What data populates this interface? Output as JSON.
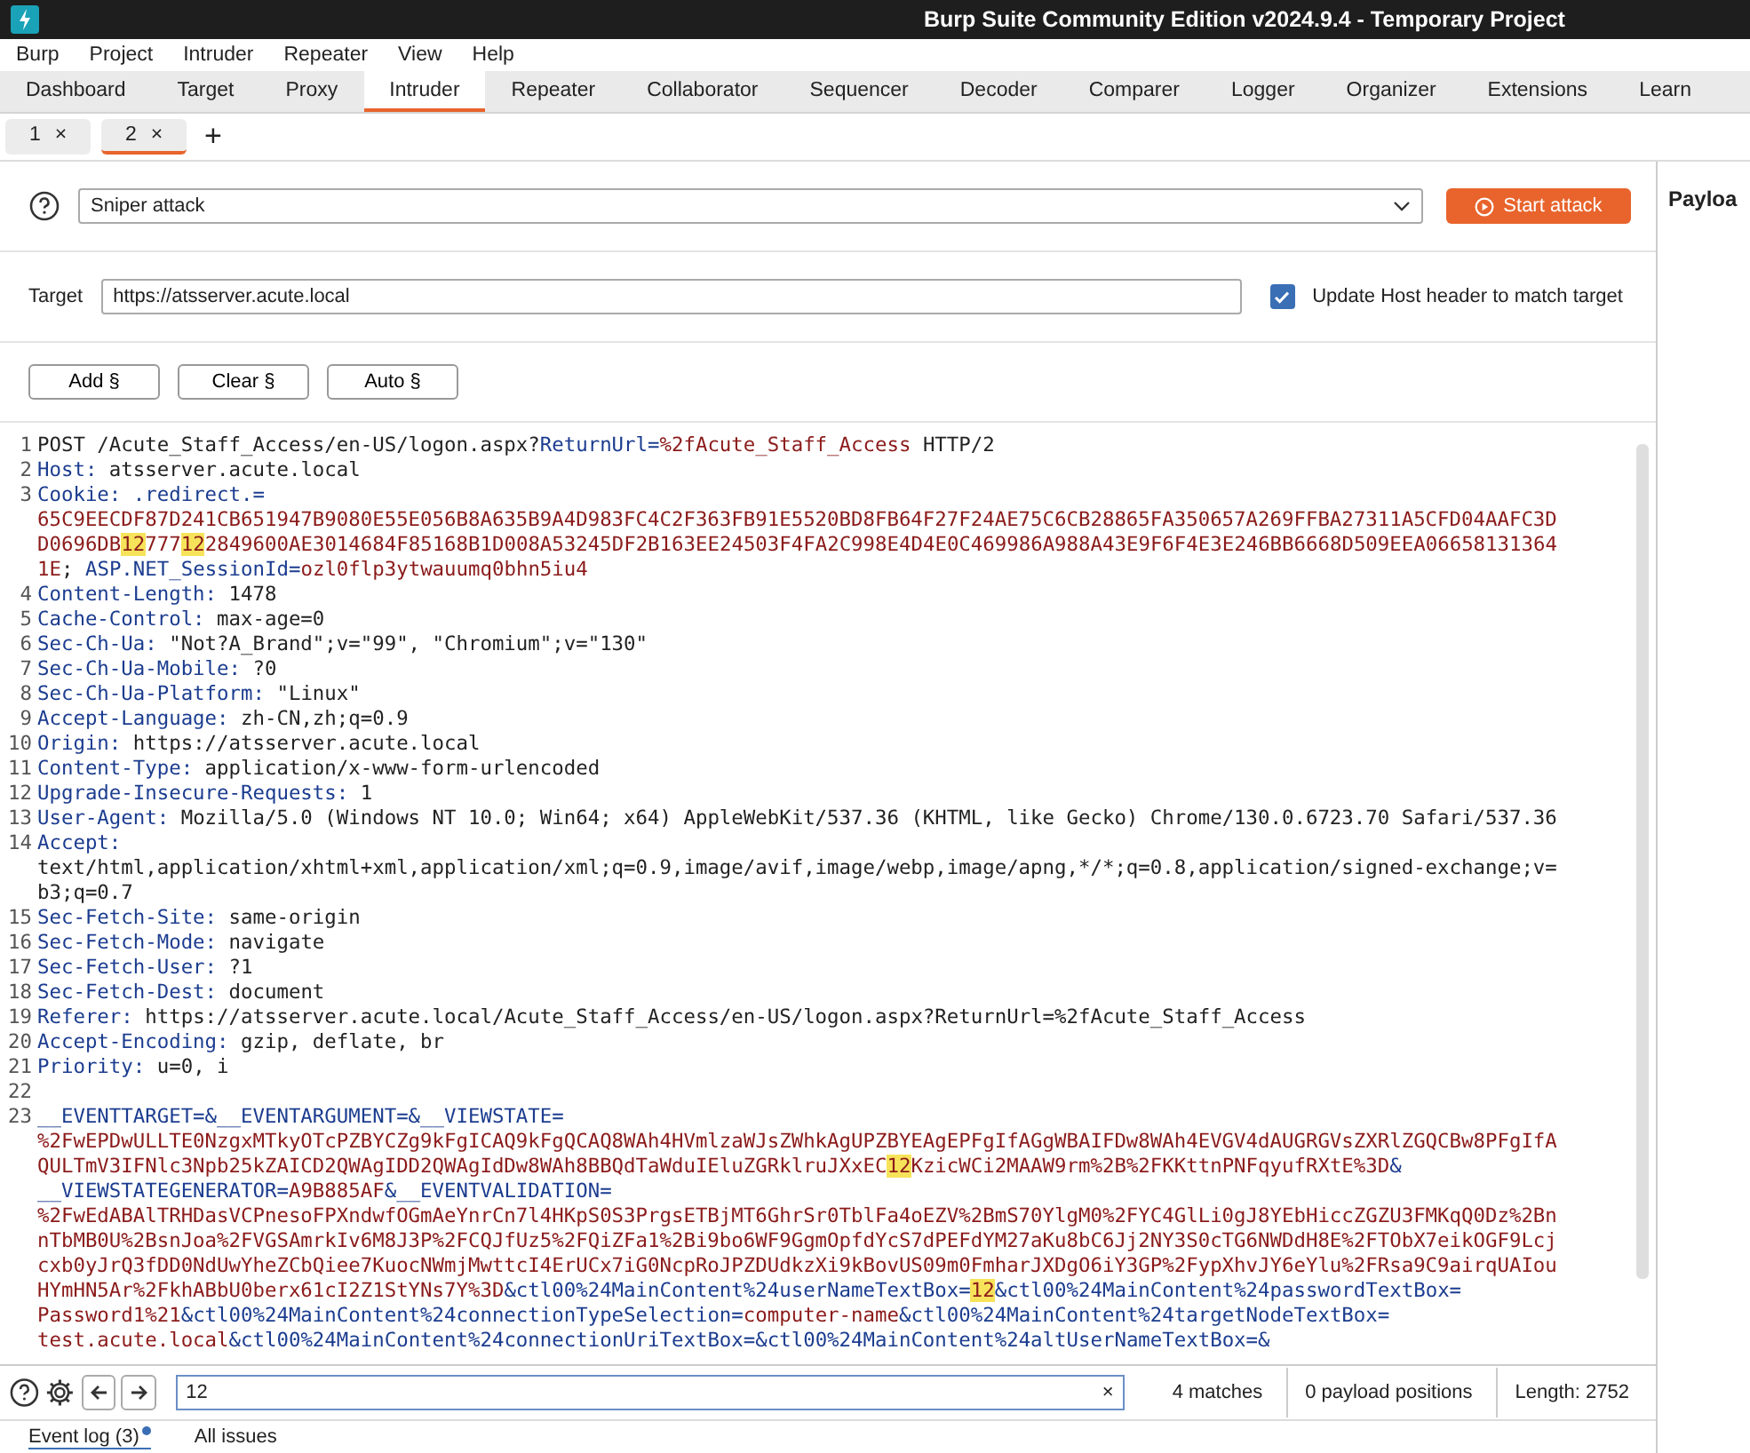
{
  "window": {
    "title": "Burp Suite Community Edition v2024.9.4 - Temporary Project"
  },
  "menu": [
    "Burp",
    "Project",
    "Intruder",
    "Repeater",
    "View",
    "Help"
  ],
  "tabs": [
    {
      "label": "Dashboard",
      "selected": false
    },
    {
      "label": "Target",
      "selected": false
    },
    {
      "label": "Proxy",
      "selected": false
    },
    {
      "label": "Intruder",
      "selected": true
    },
    {
      "label": "Repeater",
      "selected": false
    },
    {
      "label": "Collaborator",
      "selected": false
    },
    {
      "label": "Sequencer",
      "selected": false
    },
    {
      "label": "Decoder",
      "selected": false
    },
    {
      "label": "Comparer",
      "selected": false
    },
    {
      "label": "Logger",
      "selected": false
    },
    {
      "label": "Organizer",
      "selected": false
    },
    {
      "label": "Extensions",
      "selected": false
    },
    {
      "label": "Learn",
      "selected": false
    }
  ],
  "subtabs": [
    {
      "label": "1",
      "close": "×",
      "selected": false
    },
    {
      "label": "2",
      "close": "×",
      "selected": true
    }
  ],
  "new_tab": "+",
  "attack": {
    "type": "Sniper attack",
    "start_button": "Start attack"
  },
  "target": {
    "label": "Target",
    "value": "https://atsserver.acute.local",
    "update_host": {
      "label": "Update Host header to match target",
      "checked": true
    }
  },
  "position_buttons": [
    "Add §",
    "Clear §",
    "Auto §"
  ],
  "request_rows": [
    {
      "number": "1",
      "segments": [
        {
          "kind": "plain",
          "text": "POST /Acute_Staff_Access/en-US/logon.aspx?"
        },
        {
          "kind": "name",
          "text": "ReturnUrl="
        },
        {
          "kind": "value",
          "text": "%2fAcute_Staff_Access"
        },
        {
          "kind": "plain",
          "text": " HTTP/2"
        }
      ]
    },
    {
      "number": "2",
      "segments": [
        {
          "kind": "name",
          "text": "Host:"
        },
        {
          "kind": "plain",
          "text": " atsserver.acute.local"
        }
      ]
    },
    {
      "number": "3",
      "segments": [
        {
          "kind": "name",
          "text": "Cookie:"
        },
        {
          "kind": "name",
          "text": " .redirect.="
        }
      ]
    },
    {
      "segments": [
        {
          "kind": "value",
          "text": "65C9EECDF87D241CB651947B9080E55E056B8A635B9A4D983FC4C2F363FB91E5520BD8FB64F27F24AE75C6CB28865FA350657A269FFBA27311A5CFD04AAFC3D"
        }
      ]
    },
    {
      "segments": [
        {
          "kind": "value",
          "text": "D0696DB"
        },
        {
          "kind": "match",
          "text": "12"
        },
        {
          "kind": "value",
          "text": "777"
        },
        {
          "kind": "match",
          "text": "12"
        },
        {
          "kind": "value",
          "text": "2849600AE3014684F85168B1D008A53245DF2B163EE24503F4FA2C998E4D4E0C469986A988A43E9F6F4E3E246BB6668D509EEA06658131364"
        }
      ]
    },
    {
      "segments": [
        {
          "kind": "value",
          "text": "1E"
        },
        {
          "kind": "plain",
          "text": "; "
        },
        {
          "kind": "name",
          "text": "ASP.NET_SessionId="
        },
        {
          "kind": "value",
          "text": "ozl0flp3ytwauumq0bhn5iu4"
        }
      ]
    },
    {
      "number": "4",
      "segments": [
        {
          "kind": "name",
          "text": "Content-Length:"
        },
        {
          "kind": "plain",
          "text": " 1478"
        }
      ]
    },
    {
      "number": "5",
      "segments": [
        {
          "kind": "name",
          "text": "Cache-Control:"
        },
        {
          "kind": "plain",
          "text": " max-age=0"
        }
      ]
    },
    {
      "number": "6",
      "segments": [
        {
          "kind": "name",
          "text": "Sec-Ch-Ua:"
        },
        {
          "kind": "plain",
          "text": " \"Not?A_Brand\";v=\"99\", \"Chromium\";v=\"130\""
        }
      ]
    },
    {
      "number": "7",
      "segments": [
        {
          "kind": "name",
          "text": "Sec-Ch-Ua-Mobile:"
        },
        {
          "kind": "plain",
          "text": " ?0"
        }
      ]
    },
    {
      "number": "8",
      "segments": [
        {
          "kind": "name",
          "text": "Sec-Ch-Ua-Platform:"
        },
        {
          "kind": "plain",
          "text": " \"Linux\""
        }
      ]
    },
    {
      "number": "9",
      "segments": [
        {
          "kind": "name",
          "text": "Accept-Language:"
        },
        {
          "kind": "plain",
          "text": " zh-CN,zh;q=0.9"
        }
      ]
    },
    {
      "number": "10",
      "segments": [
        {
          "kind": "name",
          "text": "Origin:"
        },
        {
          "kind": "plain",
          "text": " https://atsserver.acute.local"
        }
      ]
    },
    {
      "number": "11",
      "segments": [
        {
          "kind": "name",
          "text": "Content-Type:"
        },
        {
          "kind": "plain",
          "text": " application/x-www-form-urlencoded"
        }
      ]
    },
    {
      "number": "12",
      "segments": [
        {
          "kind": "name",
          "text": "Upgrade-Insecure-Requests:"
        },
        {
          "kind": "plain",
          "text": " 1"
        }
      ]
    },
    {
      "number": "13",
      "segments": [
        {
          "kind": "name",
          "text": "User-Agent:"
        },
        {
          "kind": "plain",
          "text": " Mozilla/5.0 (Windows NT 10.0; Win64; x64) AppleWebKit/537.36 (KHTML, like Gecko) Chrome/130.0.6723.70 Safari/537.36"
        }
      ]
    },
    {
      "number": "14",
      "segments": [
        {
          "kind": "name",
          "text": "Accept:"
        }
      ]
    },
    {
      "segments": [
        {
          "kind": "plain",
          "text": "text/html,application/xhtml+xml,application/xml;q=0.9,image/avif,image/webp,image/apng,*/*;q=0.8,application/signed-exchange;v="
        }
      ]
    },
    {
      "segments": [
        {
          "kind": "plain",
          "text": "b3;q=0.7"
        }
      ]
    },
    {
      "number": "15",
      "segments": [
        {
          "kind": "name",
          "text": "Sec-Fetch-Site:"
        },
        {
          "kind": "plain",
          "text": " same-origin"
        }
      ]
    },
    {
      "number": "16",
      "segments": [
        {
          "kind": "name",
          "text": "Sec-Fetch-Mode:"
        },
        {
          "kind": "plain",
          "text": " navigate"
        }
      ]
    },
    {
      "number": "17",
      "segments": [
        {
          "kind": "name",
          "text": "Sec-Fetch-User:"
        },
        {
          "kind": "plain",
          "text": " ?1"
        }
      ]
    },
    {
      "number": "18",
      "segments": [
        {
          "kind": "name",
          "text": "Sec-Fetch-Dest:"
        },
        {
          "kind": "plain",
          "text": " document"
        }
      ]
    },
    {
      "number": "19",
      "segments": [
        {
          "kind": "name",
          "text": "Referer:"
        },
        {
          "kind": "plain",
          "text": " https://atsserver.acute.local/Acute_Staff_Access/en-US/logon.aspx?ReturnUrl=%2fAcute_Staff_Access"
        }
      ]
    },
    {
      "number": "20",
      "segments": [
        {
          "kind": "name",
          "text": "Accept-Encoding:"
        },
        {
          "kind": "plain",
          "text": " gzip, deflate, br"
        }
      ]
    },
    {
      "number": "21",
      "segments": [
        {
          "kind": "name",
          "text": "Priority:"
        },
        {
          "kind": "plain",
          "text": " u=0, i"
        }
      ]
    },
    {
      "number": "22",
      "segments": []
    },
    {
      "number": "23",
      "segments": [
        {
          "kind": "name",
          "text": "__EVENTTARGET=&__EVENTARGUMENT=&__VIEWSTATE="
        }
      ]
    },
    {
      "segments": [
        {
          "kind": "value",
          "text": "%2FwEPDwULLTE0NzgxMTkyOTcPZBYCZg9kFgICAQ9kFgQCAQ8WAh4HVmlzaWJsZWhkAgUPZBYEAgEPFgIfAGgWBAIFDw8WAh4EVGV4dAUGRGVsZXRlZGQCBw8PFgIfA"
        }
      ]
    },
    {
      "segments": [
        {
          "kind": "value",
          "text": "QULTmV3IFNlc3Npb25kZAICD2QWAgIDD2QWAgIdDw8WAh8BBQdTaWduIEluZGRklruJXxEC"
        },
        {
          "kind": "match",
          "text": "12"
        },
        {
          "kind": "value",
          "text": "KzicWCi2MAAW9rm%2B%2FKKttnPNFqyufRXtE%3D"
        },
        {
          "kind": "name",
          "text": "&"
        }
      ]
    },
    {
      "segments": [
        {
          "kind": "name",
          "text": "__VIEWSTATEGENERATOR="
        },
        {
          "kind": "value",
          "text": "A9B885AF"
        },
        {
          "kind": "name",
          "text": "&__EVENTVALIDATION="
        }
      ]
    },
    {
      "segments": [
        {
          "kind": "value",
          "text": "%2FwEdABAlTRHDasVCPnesoFPXndwfOGmAeYnrCn7l4HKpS0S3PrgsETBjMT6GhrSr0TblFa4oEZV%2BmS70YlgM0%2FYC4GlLi0gJ8YEbHiccZGZU3FMKqQ0Dz%2Bn"
        }
      ]
    },
    {
      "segments": [
        {
          "kind": "value",
          "text": "nTbMB0U%2BsnJoa%2FVGSAmrkIv6M8J3P%2FCQJfUz5%2FQiZFa1%2Bi9bo6WF9GgmOpfdYcS7dPEFdYM27aKu8bC6Jj2NY3S0cTG6NWDdH8E%2FTObX7eikOGF9Lcj"
        }
      ]
    },
    {
      "segments": [
        {
          "kind": "value",
          "text": "cxb0yJrQ3fDD0NdUwYheZCbQiee7KuocNWmjMwttcI4ErUCx7iG0NcpRoJPZDUdkzXi9kBovUS09m0FmharJXDgO6iY3GP%2FypXhvJY6eYlu%2FRsa9C9airqUAIou"
        }
      ]
    },
    {
      "segments": [
        {
          "kind": "value",
          "text": "HYmHN5Ar%2FkhABbU0berx61cI2Z1StYNs7Y%3D"
        },
        {
          "kind": "name",
          "text": "&ctl00%24MainContent%24userNameTextBox="
        },
        {
          "kind": "match",
          "text": "12"
        },
        {
          "kind": "name",
          "text": "&ctl00%24MainContent%24passwordTextBox="
        }
      ]
    },
    {
      "segments": [
        {
          "kind": "value",
          "text": "Password1%21"
        },
        {
          "kind": "name",
          "text": "&ctl00%24MainContent%24connectionTypeSelection="
        },
        {
          "kind": "value",
          "text": "computer-name"
        },
        {
          "kind": "name",
          "text": "&ctl00%24MainContent%24targetNodeTextBox="
        }
      ]
    },
    {
      "segments": [
        {
          "kind": "value",
          "text": "test.acute.local"
        },
        {
          "kind": "name",
          "text": "&ctl00%24MainContent%24connectionUriTextBox=&ctl00%24MainContent%24altUserNameTextBox=&"
        }
      ]
    }
  ],
  "search": {
    "value": "12",
    "clear": "×",
    "matches": "4 matches",
    "payload_positions": "0 payload positions",
    "length": "Length: 2752"
  },
  "side_panel": {
    "title": "Payloa"
  },
  "bottom_tabs": [
    {
      "label": "Event log (3)",
      "notification": true
    },
    {
      "label": "All issues",
      "notification": false
    }
  ]
}
